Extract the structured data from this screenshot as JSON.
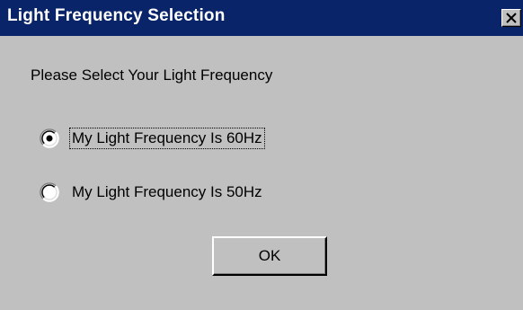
{
  "window": {
    "title": "Light Frequency Selection",
    "close_icon": "close-icon"
  },
  "dialog": {
    "prompt": "Please Select Your Light Frequency",
    "options": [
      {
        "label": "My Light Frequency Is 60Hz",
        "selected": true
      },
      {
        "label": "My Light Frequency Is 50Hz",
        "selected": false
      }
    ],
    "ok_label": "OK"
  },
  "colors": {
    "titlebar": "#0a246a",
    "face": "#c0c0c0"
  }
}
